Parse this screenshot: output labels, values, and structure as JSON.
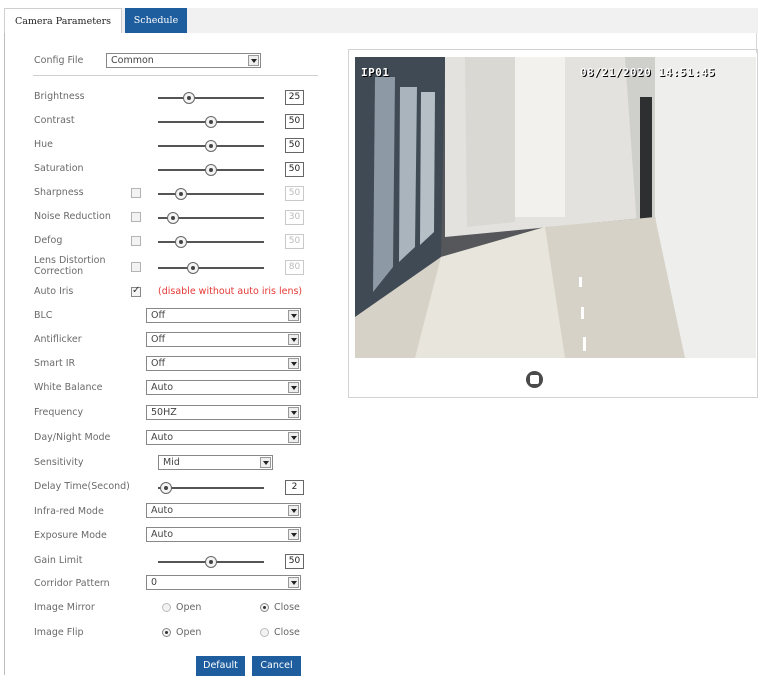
{
  "tabs": {
    "active": "Camera Parameters",
    "inactive": "Schedule"
  },
  "config_file": {
    "label": "Config File",
    "value": "Common"
  },
  "sliders": {
    "brightness": {
      "label": "Brightness",
      "value": "25"
    },
    "contrast": {
      "label": "Contrast",
      "value": "50"
    },
    "hue": {
      "label": "Hue",
      "value": "50"
    },
    "saturation": {
      "label": "Saturation",
      "value": "50"
    },
    "sharpness": {
      "label": "Sharpness",
      "value": "50"
    },
    "noise_reduction": {
      "label": "Noise Reduction",
      "value": "30"
    },
    "defog": {
      "label": "Defog",
      "value": "50"
    },
    "lens_distortion": {
      "label": "Lens Distortion Correction",
      "value": "80"
    },
    "delay_time": {
      "label": "Delay Time(Second)",
      "value": "2"
    },
    "gain_limit": {
      "label": "Gain Limit",
      "value": "50"
    }
  },
  "auto_iris": {
    "label": "Auto Iris",
    "note": "(disable without auto iris lens)"
  },
  "selects": {
    "blc": {
      "label": "BLC",
      "value": "Off"
    },
    "antiflicker": {
      "label": "Antiflicker",
      "value": "Off"
    },
    "smart_ir": {
      "label": "Smart IR",
      "value": "Off"
    },
    "white_balance": {
      "label": "White Balance",
      "value": "Auto"
    },
    "frequency": {
      "label": "Frequency",
      "value": "50HZ"
    },
    "day_night": {
      "label": "Day/Night Mode",
      "value": "Auto"
    },
    "sensitivity": {
      "label": "Sensitivity",
      "value": "Mid"
    },
    "infrared": {
      "label": "Infra-red Mode",
      "value": "Auto"
    },
    "exposure": {
      "label": "Exposure Mode",
      "value": "Auto"
    },
    "corridor": {
      "label": "Corridor Pattern",
      "value": "0"
    }
  },
  "image_mirror": {
    "label": "Image Mirror",
    "open": "Open",
    "close": "Close"
  },
  "image_flip": {
    "label": "Image Flip",
    "open": "Open",
    "close": "Close"
  },
  "buttons": {
    "default": "Default",
    "cancel": "Cancel"
  },
  "preview": {
    "camera_name": "IP01",
    "timestamp": "08/21/2020 14:51:45"
  },
  "colors": {
    "accent": "#1f5e9e",
    "warning": "#e53935"
  },
  "icons": {
    "stop": "stop-icon",
    "dropdown": "chevron-down-icon"
  }
}
